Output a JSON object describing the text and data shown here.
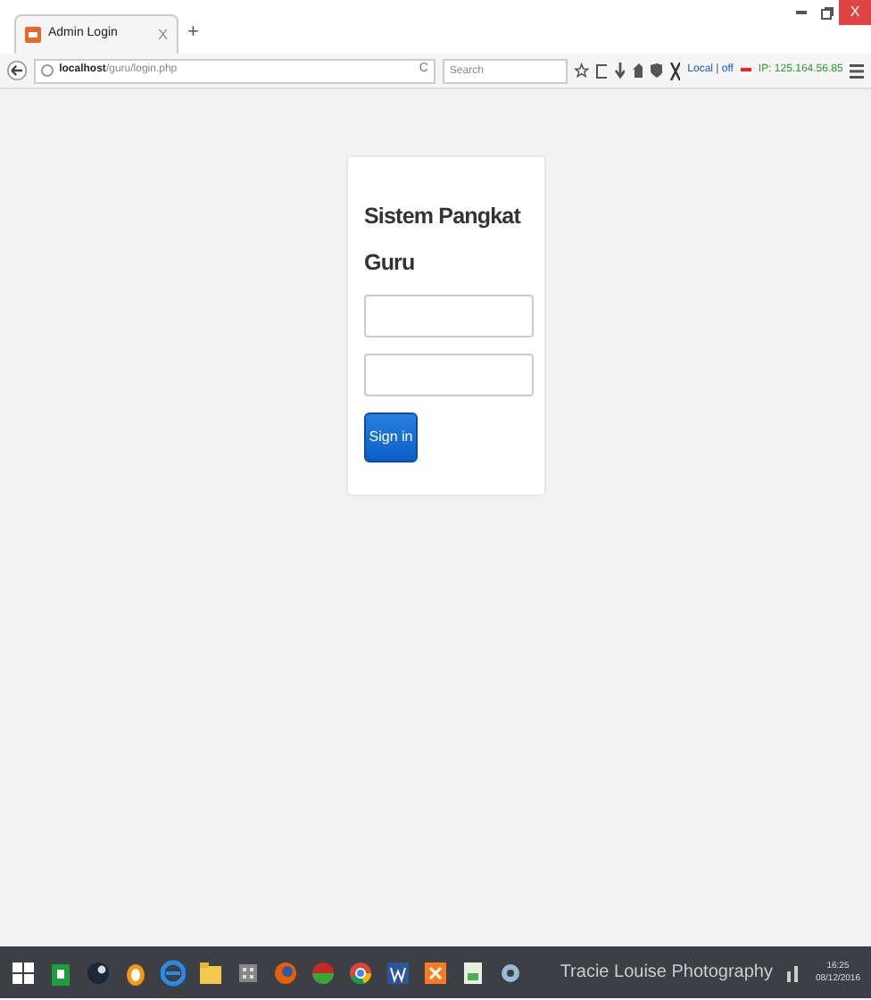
{
  "browser": {
    "tab": {
      "title": "Admin Login",
      "close": "X",
      "selected": true
    },
    "new_tab": "+",
    "url_host": "localhost",
    "url_path": "/guru/login.php",
    "reload": "C",
    "search": {
      "placeholder": "Search"
    },
    "addon_status": "Local | off",
    "addon_ip": "IP: 125.164.56.85",
    "close_window": "X"
  },
  "login": {
    "heading": "Sistem Pangkat Guru",
    "button": "Sign in"
  },
  "taskbar": {
    "wallpaper_caption": "Tracie Louise Photography",
    "time": "16:25",
    "date": "08/12/2016"
  }
}
